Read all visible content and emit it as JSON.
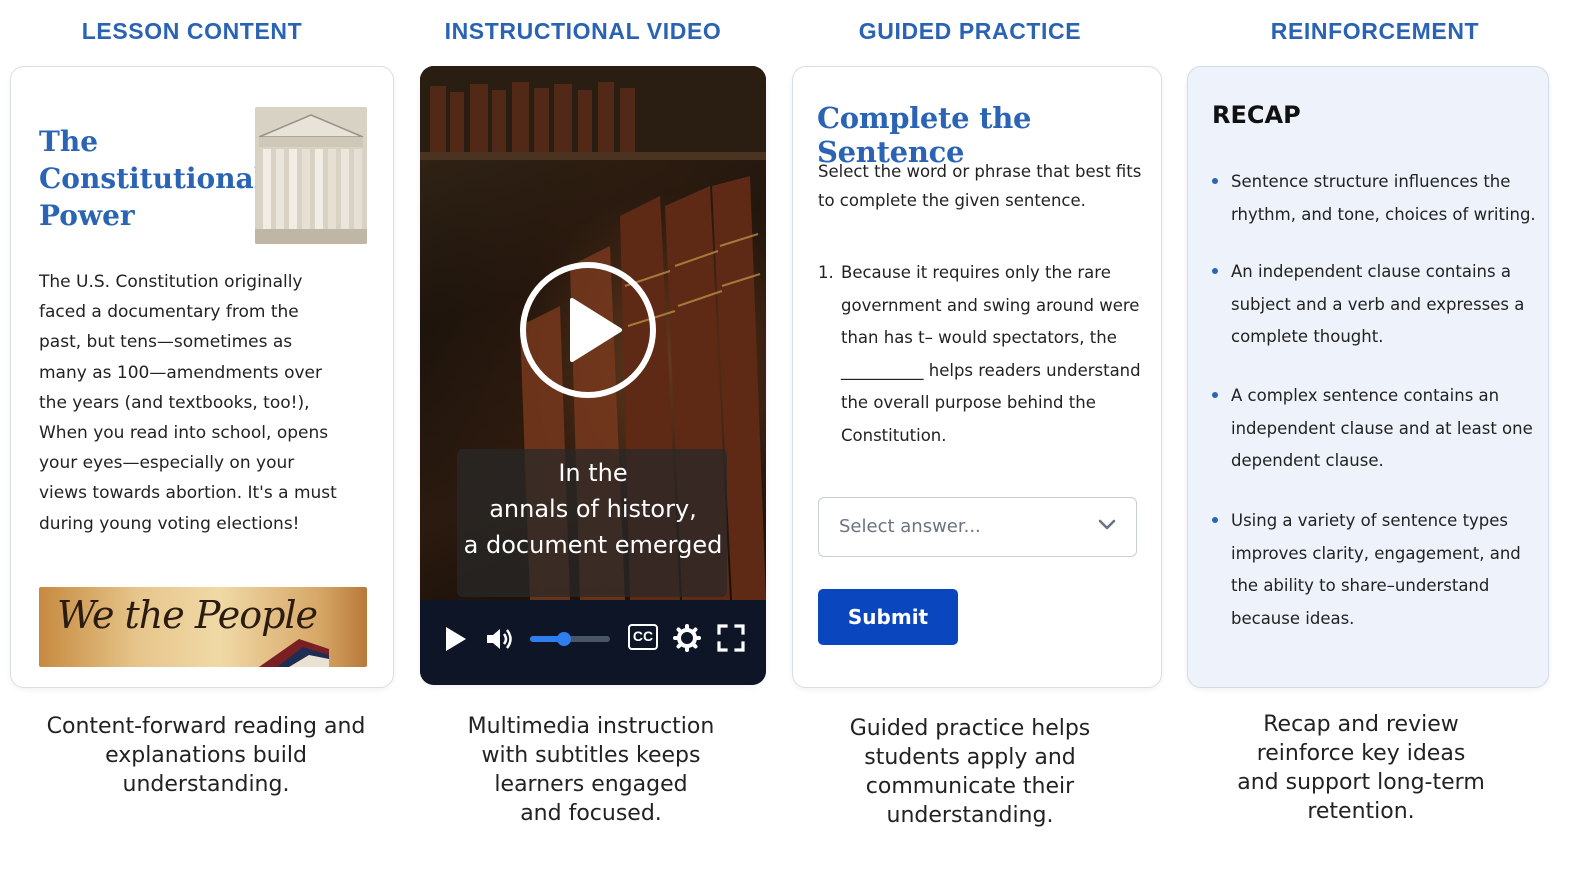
{
  "columns": {
    "lesson": {
      "heading": "LESSON CONTENT",
      "title": "The Constitutional Power",
      "body": "The U.S. Constitution originally faced a documentary from the past, but tens—sometimes as many as 100—amendments over the years (and textbooks, too!), When you read into school, opens your eyes—especially on your views towards abortion. It's a must during young voting elections!",
      "document_image_text": "We the People",
      "caption": "Content-forward reading and\nexplanations build\nunderstanding."
    },
    "video": {
      "heading": "INSTRUCTIONAL VIDEO",
      "subtitle_lines": [
        "In the",
        "annals of history,",
        "a document emerged"
      ],
      "cc_label": "CC",
      "progress": 0.42,
      "caption": "Multimedia instruction\nwith subtitles keeps\nlearners engaged\nand focused."
    },
    "practice": {
      "heading": "GUIDED PRACTICE",
      "title": "Complete the Sentence",
      "instructions": "Select the word or phrase that best fits to complete the given sentence.",
      "question_number": "1.",
      "question_text": "Because it requires only the rare government and swing around were than has t– would spectators, the __________ helps readers understand the overall purpose behind the Constitution.",
      "select_placeholder": "Select answer...",
      "submit_label": "Submit",
      "caption": "Guided practice helps\nstudents apply and\ncommunicate their\nunderstanding."
    },
    "reinforcement": {
      "heading": "REINFORCEMENT",
      "title": "RECAP",
      "items": [
        "Sentence structure influences the rhythm, and tone, choices of writing.",
        "An independent clause contains a subject and a verb and expresses a complete thought.",
        "A complex sentence contains an independent clause and at least one dependent clause.",
        "Using a variety of sentence types improves clarity, engagement, and the ability to share–understand because ideas."
      ],
      "caption": "Recap and review\nreinforce key ideas\nand support long-term\nretention."
    }
  },
  "colors": {
    "heading_blue": "#2a62b4",
    "title_blue": "#2b64b5",
    "submit_blue": "#0a46be",
    "recap_bg": "#eef2fa",
    "video_controls_bg": "#0d1526",
    "progress_blue": "#2f7ef0"
  },
  "icons": {
    "video_play": "play-icon",
    "video_controls": [
      "play-icon",
      "volume-icon",
      "cc-icon",
      "gear-icon",
      "fullscreen-icon"
    ],
    "select": "chevron-down-icon"
  }
}
